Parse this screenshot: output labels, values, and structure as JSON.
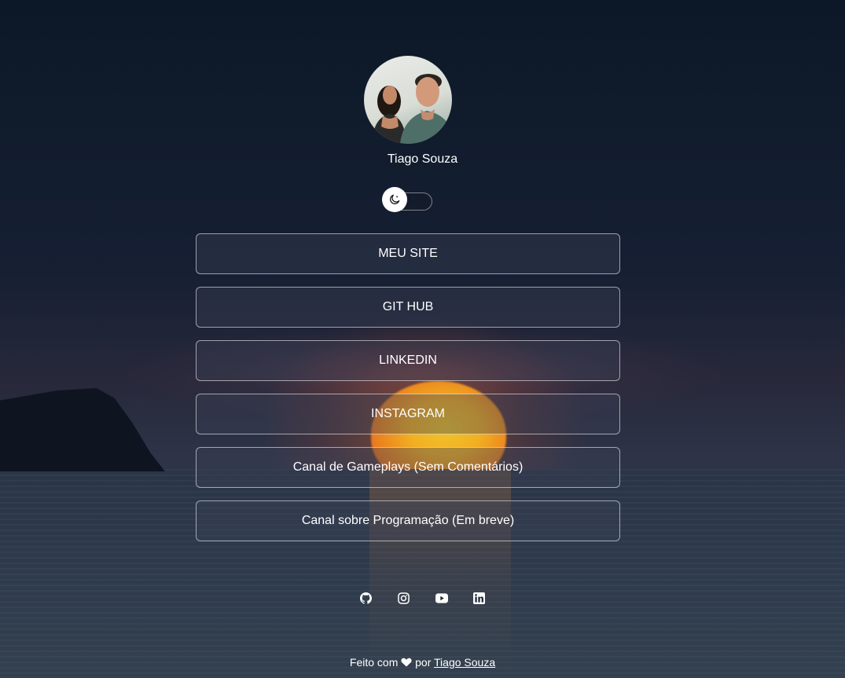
{
  "profile": {
    "name": "Tiago Souza"
  },
  "theme_toggle": {
    "icon": "moon-icon",
    "state": "dark"
  },
  "links": [
    {
      "label": "MEU SITE"
    },
    {
      "label": "GIT HUB"
    },
    {
      "label": "LINKEDIN"
    },
    {
      "label": "INSTAGRAM"
    },
    {
      "label": "Canal de Gameplays (Sem Comentários)"
    },
    {
      "label": "Canal sobre Programação (Em breve)"
    }
  ],
  "social": [
    {
      "icon": "github-icon"
    },
    {
      "icon": "instagram-icon"
    },
    {
      "icon": "youtube-icon"
    },
    {
      "icon": "linkedin-icon"
    }
  ],
  "footer": {
    "prefix": "Feito com",
    "middle": "por",
    "author_link": "Tiago Souza"
  },
  "colors": {
    "text": "#ffffff",
    "button_border": "#c8ccd4",
    "background_top": "#0c1828"
  }
}
